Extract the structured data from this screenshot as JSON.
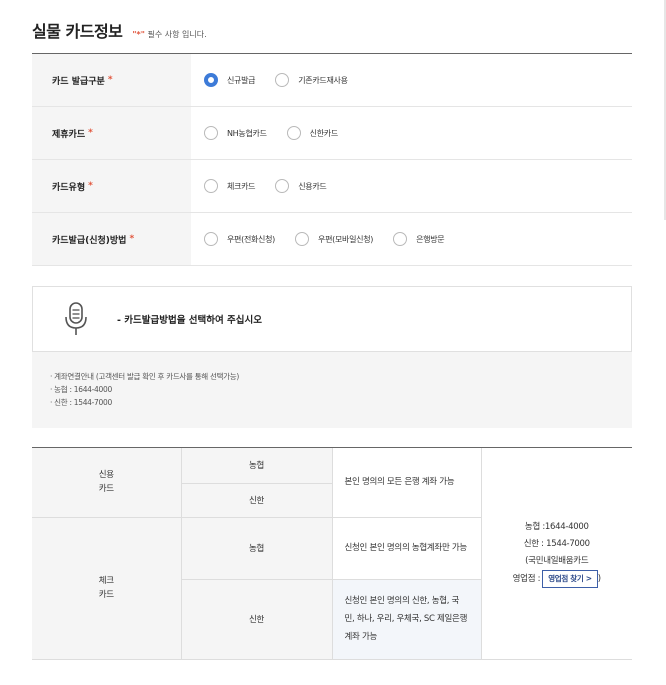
{
  "header": {
    "title": "실물 카드정보",
    "note_star": "\"*\"",
    "note": " 필수 사항 입니다."
  },
  "form": {
    "rows": [
      {
        "label": "카드 발급구분",
        "star": "*",
        "options": [
          "신규발급",
          "기존카드재사용"
        ],
        "selected": 0
      },
      {
        "label": "제휴카드",
        "star": "*",
        "options": [
          "NH농협카드",
          "신한카드"
        ],
        "selected": -1
      },
      {
        "label": "카드유형",
        "star": "*",
        "options": [
          "체크카드",
          "신용카드"
        ],
        "selected": -1
      },
      {
        "label": "카드발급(신청)방법",
        "star": "*",
        "options": [
          "우편(전화신청)",
          "우편(모바일신청)",
          "은행방문"
        ],
        "selected": -1
      }
    ]
  },
  "info": {
    "icon": "microphone-icon",
    "message": "- 카드발급방법을 선택하여 주십시오",
    "lines": [
      "· 계좌연결안내 (고객센터 발급 확인 후 카드사를 통해 선택가능)",
      "· 농협 : 1644-4000",
      "· 신한 : 1544-7000"
    ]
  },
  "table": {
    "credit_label": "신용\n카드",
    "check_label": "체크\n카드",
    "credit_nh": "농협",
    "credit_sh": "신한",
    "credit_desc": "본인 명의의 모든 은행 계좌 가능",
    "check_nh": "농협",
    "check_nh_desc": "신청인 본인 명의의 농협계좌만 가능",
    "check_sh": "신한",
    "check_sh_desc": "신청인 본인 명의의 신한, 농협, 국민, 하나, 우리, 우체국, SC 제일은행 계좌 가능",
    "contact_nh": "농협 :1644-4000",
    "contact_sh": "신한 : 1544-7000",
    "contact_note": "(국민내일배움카드",
    "contact_branch": "영업점 :",
    "branch_button": "영업점 찾기 >",
    "contact_close": ")"
  },
  "colors": {
    "accent": "#3d7bd8",
    "required": "#e1553c"
  }
}
